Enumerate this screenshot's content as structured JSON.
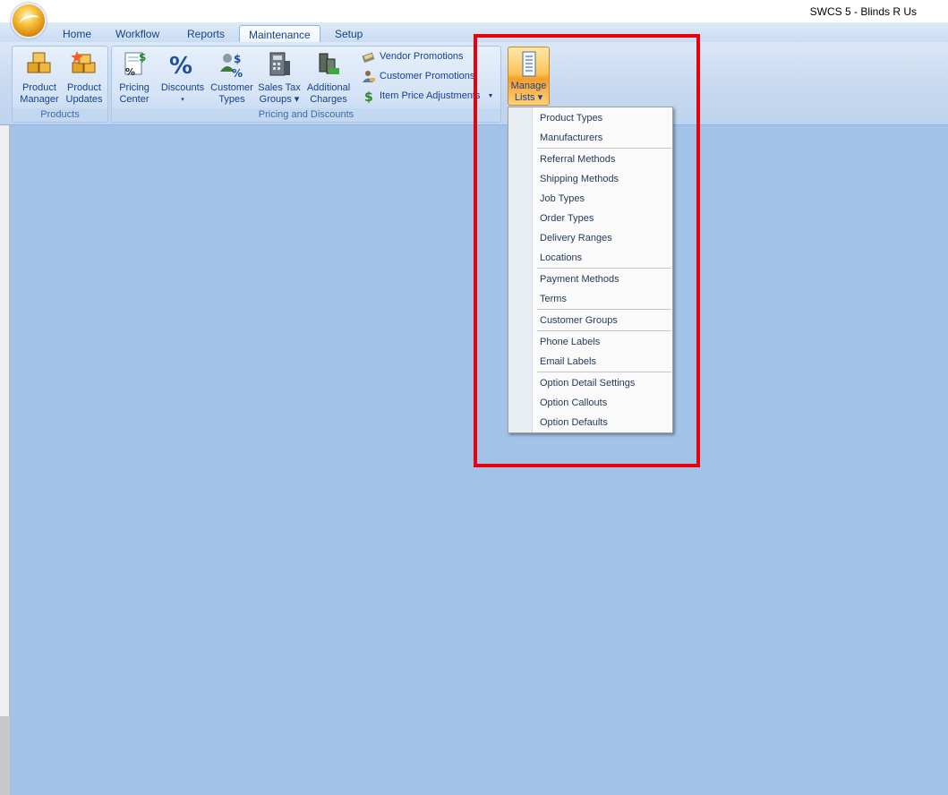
{
  "window": {
    "title": "SWCS 5 - Blinds R Us"
  },
  "tabs": [
    "Home",
    "Workflow",
    "Reports",
    "Maintenance",
    "Setup"
  ],
  "active_tab": "Maintenance",
  "groups": {
    "products": {
      "label": "Products",
      "buttons": [
        {
          "line1": "Product",
          "line2": "Manager",
          "icon": "boxes-icon"
        },
        {
          "line1": "Product",
          "line2": "Updates",
          "icon": "boxes-star-icon"
        }
      ]
    },
    "pricing": {
      "label": "Pricing and Discounts",
      "buttons": [
        {
          "line1": "Pricing",
          "line2": "Center",
          "icon": "price-sheet-icon"
        },
        {
          "line1": "Discounts",
          "line2": "▾",
          "icon": "percent-icon"
        },
        {
          "line1": "Customer",
          "line2": "Types",
          "icon": "customer-dollar-icon"
        },
        {
          "line1": "Sales Tax",
          "line2": "Groups ▾",
          "icon": "calculator-icon"
        },
        {
          "line1": "Additional",
          "line2": "Charges",
          "icon": "money-stack-icon"
        }
      ],
      "small_buttons": [
        {
          "label": "Vendor Promotions",
          "icon": "vendor-promo-icon"
        },
        {
          "label": "Customer Promotions",
          "icon": "customer-promo-icon"
        },
        {
          "label": "Item Price Adjustments",
          "icon": "dollar-icon"
        }
      ]
    }
  },
  "manage_lists": {
    "line1": "Manage",
    "line2": "Lists ▾",
    "icon": "list-document-icon"
  },
  "menu": {
    "sections": [
      [
        "Product Types",
        "Manufacturers"
      ],
      [
        "Referral Methods",
        "Shipping Methods",
        "Job Types",
        "Order Types",
        "Delivery Ranges",
        "Locations"
      ],
      [
        "Payment Methods",
        "Terms"
      ],
      [
        "Customer Groups"
      ],
      [
        "Phone Labels",
        "Email Labels"
      ],
      [
        "Option Detail Settings",
        "Option Callouts",
        "Option Defaults"
      ]
    ]
  },
  "colors": {
    "workspace": "#a3c2e8",
    "highlight_box": "#e8000b",
    "manage_lists_active": "#f89d2c"
  }
}
